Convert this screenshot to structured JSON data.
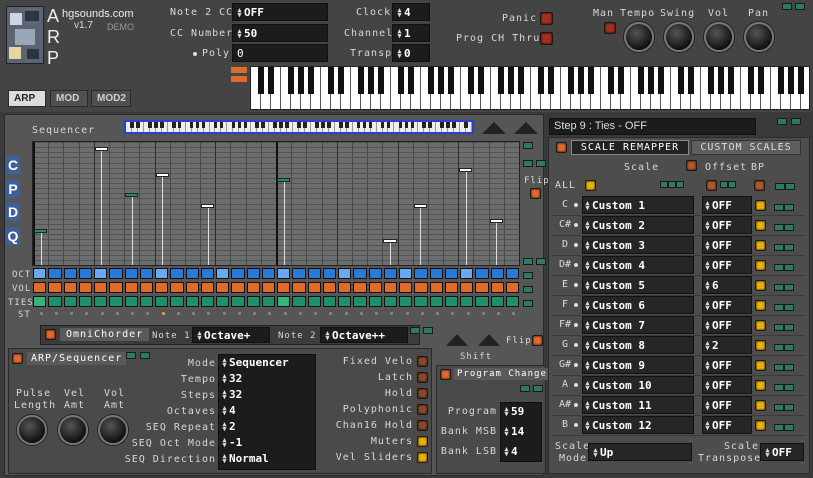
{
  "app": {
    "name": "ARP",
    "site": "hgsounds.com",
    "version": "v1.7",
    "edition": "DEMO"
  },
  "tabs": [
    "ARP",
    "MOD",
    "MOD2"
  ],
  "top": {
    "note2cc": {
      "label": "Note 2 CC",
      "value": "OFF"
    },
    "ccnumber": {
      "label": "CC Number",
      "value": "50"
    },
    "poly": {
      "label": "Poly",
      "value": "0"
    },
    "clock": {
      "label": "Clock",
      "value": "4"
    },
    "channel": {
      "label": "Channel",
      "value": "1"
    },
    "transp": {
      "label": "Transp",
      "value": "0"
    },
    "panic": "Panic",
    "progchthru": "Prog CH Thru",
    "knobs": [
      "Man",
      "Tempo",
      "Swing",
      "Vol",
      "Pan"
    ]
  },
  "sequencer": {
    "title": "Sequencer",
    "cpdq": [
      "C",
      "P",
      "D",
      "Q"
    ],
    "rows": [
      "OCT",
      "VOL",
      "TIES",
      "ST"
    ],
    "flip": "Flip",
    "shift": "Shift",
    "flip2": "Flip"
  },
  "omni": {
    "title": "OmniChorder",
    "note1_label": "Note 1",
    "note1": "Octave+",
    "note2_label": "Note 2",
    "note2": "Octave++"
  },
  "arpseq": {
    "title": "ARP/Sequencer",
    "knobs": [
      {
        "l1": "Pulse",
        "l2": "Length"
      },
      {
        "l1": "Vel",
        "l2": "Amt"
      },
      {
        "l1": "Vol",
        "l2": "Amt"
      }
    ],
    "params": [
      {
        "label": "Mode",
        "value": "Sequencer"
      },
      {
        "label": "Tempo",
        "value": "32"
      },
      {
        "label": "Steps",
        "value": "32"
      },
      {
        "label": "Octaves",
        "value": "4"
      },
      {
        "label": "SEQ Repeat",
        "value": "2"
      },
      {
        "label": "SEQ Oct Mode",
        "value": "-1"
      },
      {
        "label": "SEQ Direction",
        "value": "Normal"
      }
    ],
    "toggles": [
      "Fixed Velo",
      "Latch",
      "Hold",
      "Polyphonic",
      "Chan16 Hold",
      "Muters",
      "Vel Sliders"
    ]
  },
  "program": {
    "title": "Program Change",
    "rows": [
      {
        "label": "Program",
        "value": "59"
      },
      {
        "label": "Bank MSB",
        "value": "14"
      },
      {
        "label": "Bank LSB",
        "value": "4"
      }
    ]
  },
  "status": "Step 9 : Ties - OFF",
  "scale": {
    "tabs": [
      "Scale Remapper",
      "Custom Scales"
    ],
    "headers": {
      "scale": "Scale",
      "offset": "Offset",
      "bp": "BP"
    },
    "all": "ALL",
    "rows": [
      {
        "note": "C",
        "scale": "Custom 1",
        "offset": "OFF"
      },
      {
        "note": "C#",
        "scale": "Custom 2",
        "offset": "OFF"
      },
      {
        "note": "D",
        "scale": "Custom 3",
        "offset": "OFF"
      },
      {
        "note": "D#",
        "scale": "Custom 4",
        "offset": "OFF"
      },
      {
        "note": "E",
        "scale": "Custom 5",
        "offset": "6"
      },
      {
        "note": "F",
        "scale": "Custom 6",
        "offset": "OFF"
      },
      {
        "note": "F#",
        "scale": "Custom 7",
        "offset": "OFF"
      },
      {
        "note": "G",
        "scale": "Custom 8",
        "offset": "2"
      },
      {
        "note": "G#",
        "scale": "Custom 9",
        "offset": "OFF"
      },
      {
        "note": "A",
        "scale": "Custom 10",
        "offset": "OFF"
      },
      {
        "note": "A#",
        "scale": "Custom 11",
        "offset": "OFF"
      },
      {
        "note": "B",
        "scale": "Custom 12",
        "offset": "OFF"
      }
    ],
    "mode_label1": "Scale",
    "mode_label2": "Mode",
    "mode": "Up",
    "transpose_label1": "Scale",
    "transpose_label2": "Transpose",
    "transpose": "OFF"
  },
  "colors": {
    "accent": "#e06a2a",
    "blue": "#3f5f9a",
    "led_red": "#a3301f",
    "led_yellow": "#e8b40c",
    "green": "#1f8f6a"
  }
}
